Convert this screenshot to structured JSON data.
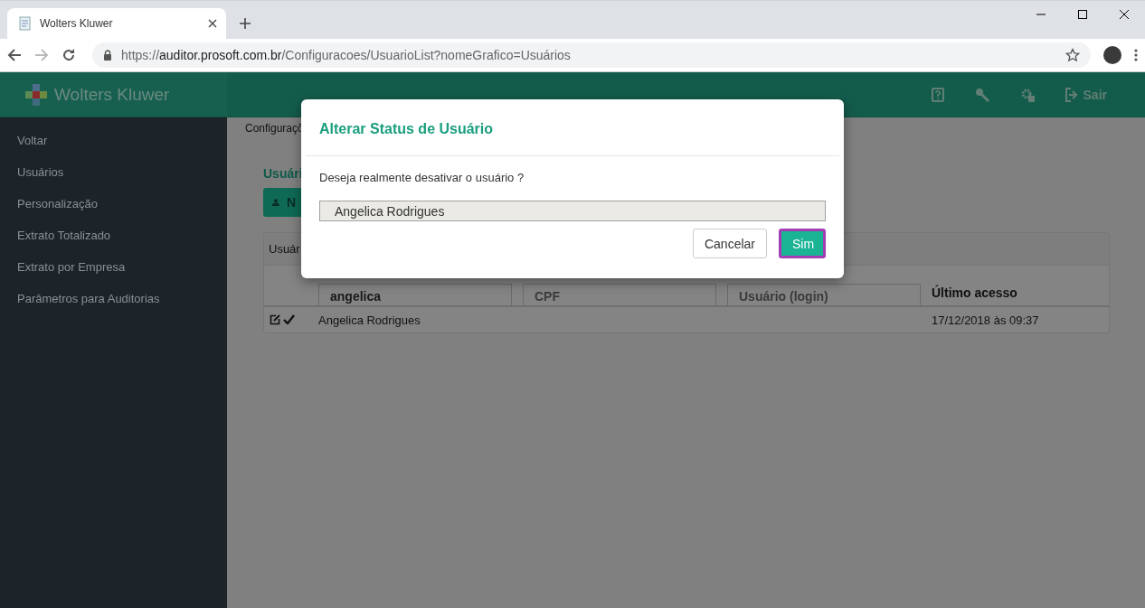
{
  "browser": {
    "tab_title": "Wolters Kluwer",
    "url_scheme": "https://",
    "url_host": "auditor.prosoft.com.br",
    "url_path": "/Configuracoes/UsuarioList?nomeGrafico=Usuários"
  },
  "header": {
    "logo": "Wolters Kluwer",
    "logout": "Sair"
  },
  "sidebar": {
    "items": [
      {
        "label": "Voltar"
      },
      {
        "label": "Usuários"
      },
      {
        "label": "Personalização"
      },
      {
        "label": "Extrato Totalizado"
      },
      {
        "label": "Extrato por Empresa"
      },
      {
        "label": "Parâmetros para Auditorias"
      }
    ]
  },
  "breadcrumb": "Configuraçõ",
  "page_title": "Usuári",
  "new_button": "N",
  "table": {
    "title": "Usuár",
    "filters": [
      {
        "value": "angelica"
      },
      {
        "placeholder": "CPF"
      },
      {
        "placeholder": "Usuário (login)"
      }
    ],
    "last_column": "Último acesso",
    "rows": [
      {
        "name": "Angelica Rodrigues",
        "last_access": "17/12/2018 às 09:37",
        "active": true
      }
    ]
  },
  "dialog": {
    "title": "Alterar Status de Usuário",
    "message": "Deseja realmente desativar o usuário ?",
    "user": "Angelica Rodrigues",
    "buttons": [
      {
        "label": "Cancelar",
        "kind": "default"
      },
      {
        "label": "Sim",
        "kind": "primary"
      }
    ]
  }
}
